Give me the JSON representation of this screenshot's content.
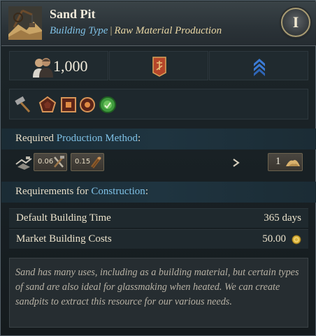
{
  "header": {
    "title": "Sand Pit",
    "type_label": "Building Type",
    "separator": "|",
    "category": "Raw Material Production",
    "info_button_label": "I",
    "building_icon": "sand-pit-icon"
  },
  "stats": {
    "population": "1,000",
    "population_icon": "population-icon",
    "banner_icon": "banner-icon",
    "rank_icon": "rank-chevrons-icon"
  },
  "techs": [
    "hammer-icon",
    "pentagon-badge-icon",
    "square-badge-icon",
    "circle-badge-icon",
    "green-seal-icon"
  ],
  "production": {
    "heading_prefix": "Required",
    "heading_accent": "Production Method",
    "heading_suffix": ":",
    "method_icon": "quarry-method-icon",
    "inputs": [
      {
        "amount": "0.06",
        "icon": "tools-icon"
      },
      {
        "amount": "0.15",
        "icon": "wood-icon"
      }
    ],
    "arrow_icon": "arrow-right-icon",
    "output": {
      "amount": "1",
      "icon": "sand-icon"
    }
  },
  "construction": {
    "heading_prefix": "Requirements for",
    "heading_accent": "Construction",
    "heading_suffix": ":",
    "rows": [
      {
        "label": "Default Building Time",
        "value": "365 days"
      },
      {
        "label": "Market Building Costs",
        "value": "50.00"
      }
    ],
    "coin_icon": "gold-coin-icon"
  },
  "description": "Sand has many uses, including as a building material, but certain types of sand are also ideal for glassmaking when heated. We can create sandpits to extract this resource for our various needs.",
  "colors": {
    "accent_blue": "#7fc1e6",
    "category_gold": "#e8d6a4",
    "panel_bg": "#1a2226"
  }
}
